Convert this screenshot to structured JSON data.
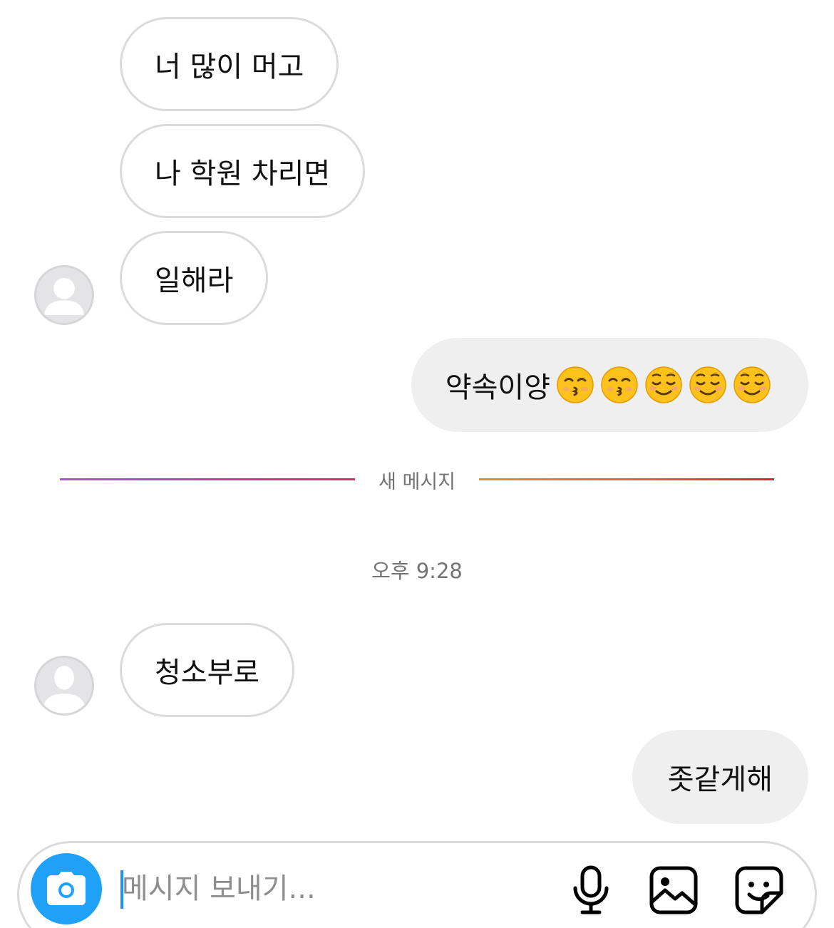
{
  "messages": [
    {
      "side": "in",
      "text": "너 많이 머고"
    },
    {
      "side": "in",
      "text": "나 학원 차리면"
    },
    {
      "side": "in",
      "text": "일해라"
    },
    {
      "side": "out",
      "text": "약속이양"
    },
    {
      "side": "in",
      "text": "청소부로"
    },
    {
      "side": "out",
      "text": "좃같게해"
    }
  ],
  "emojis_after_promise": [
    "kissing-face",
    "kissing-face",
    "smiling-face",
    "smiling-face",
    "smiling-face"
  ],
  "divider": {
    "label": "새 메시지"
  },
  "timestamp": "오후 9:28",
  "composer": {
    "placeholder": "메시지 보내기...",
    "icons": [
      "camera-icon",
      "microphone-icon",
      "image-icon",
      "sticker-icon"
    ]
  },
  "colors": {
    "accent_blue": "#1ea1f7",
    "incoming_border": "#dbdbdb",
    "outgoing_bg": "#efefef",
    "muted_text": "#737373"
  }
}
